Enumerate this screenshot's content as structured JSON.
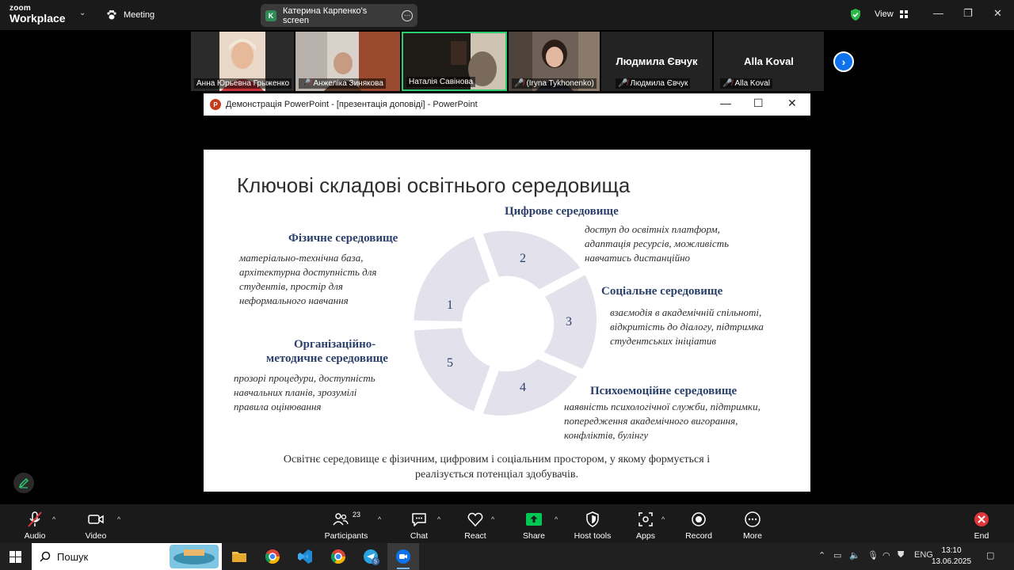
{
  "app": {
    "logo_line1": "zoom",
    "logo_line2": "Workplace",
    "meeting_label": "Meeting",
    "share_indicator_initial": "K",
    "share_indicator_text": "Катерина Карпенко's screen",
    "view_label": "View"
  },
  "participants": [
    {
      "name": "Анна Юрьевна Грыженко",
      "muted": false,
      "video": true
    },
    {
      "name": "Анжеліка Зинякова",
      "muted": true,
      "video": true
    },
    {
      "name": "Наталія Савінова",
      "muted": false,
      "video": true,
      "active_speaker": true
    },
    {
      "name": "(Iryna Tykhonenko)",
      "muted": true,
      "video": true
    },
    {
      "name": "Людмила Євчук",
      "muted": true,
      "video": false,
      "big_label": "Людмила Євчук"
    },
    {
      "name": "Alla Koval",
      "muted": true,
      "video": false,
      "big_label": "Alla Koval"
    }
  ],
  "shared_window": {
    "title": "Демонстрація PowerPoint - [презентація доповіді] - PowerPoint"
  },
  "slide": {
    "title": "Ключові складові освітнього середовища",
    "segments": [
      "1",
      "2",
      "3",
      "4",
      "5"
    ],
    "blocks": {
      "physical": {
        "heading": "Фізичне середовище",
        "lines": [
          "матеріально-технічна база,",
          "архітектурна доступність для",
          "студентів, простір для",
          "неформального навчання"
        ]
      },
      "digital": {
        "heading": "Цифрове середовище",
        "lines": [
          "доступ до освітніх платформ,",
          "адаптація ресурсів, можливість",
          "навчатись дистанційно"
        ]
      },
      "social": {
        "heading": "Соціальне середовище",
        "lines": [
          "взаємодія в академічній спільноті,",
          "відкритість до діалогу, підтримка",
          "студентських ініціатив"
        ]
      },
      "organizational": {
        "heading_line1": "Організаційно-",
        "heading_line2": "методичне середовище",
        "lines": [
          "прозорі процедури, доступність",
          "навчальних планів, зрозумілі",
          "правила оцінювання"
        ]
      },
      "psycho": {
        "heading": "Психоемоційне середовище",
        "lines": [
          "наявність психологічної служби, підтримки,",
          "попередження академічного вигорання,",
          "конфліктів, булінгу"
        ]
      }
    },
    "summary_line1": "Освітнє середовище є фізичним, цифровим і соціальним простором, у якому формується і",
    "summary_line2": "реалізується потенціал здобувачів."
  },
  "toolbar": {
    "audio": "Audio",
    "video": "Video",
    "participants": "Participants",
    "participants_count": "23",
    "chat": "Chat",
    "react": "React",
    "share": "Share",
    "host_tools": "Host tools",
    "apps": "Apps",
    "record": "Record",
    "more": "More",
    "end": "End"
  },
  "taskbar": {
    "search_placeholder": "Пошук",
    "language": "ENG",
    "time": "13:10",
    "date": "13.06.2025",
    "badge_count": "5"
  },
  "colors": {
    "zoom_blue": "#0e72ed",
    "share_green": "#00c853",
    "end_red": "#e0353b",
    "slide_heading": "#2a3f6a",
    "donut_segment": "#e3e2ec"
  }
}
